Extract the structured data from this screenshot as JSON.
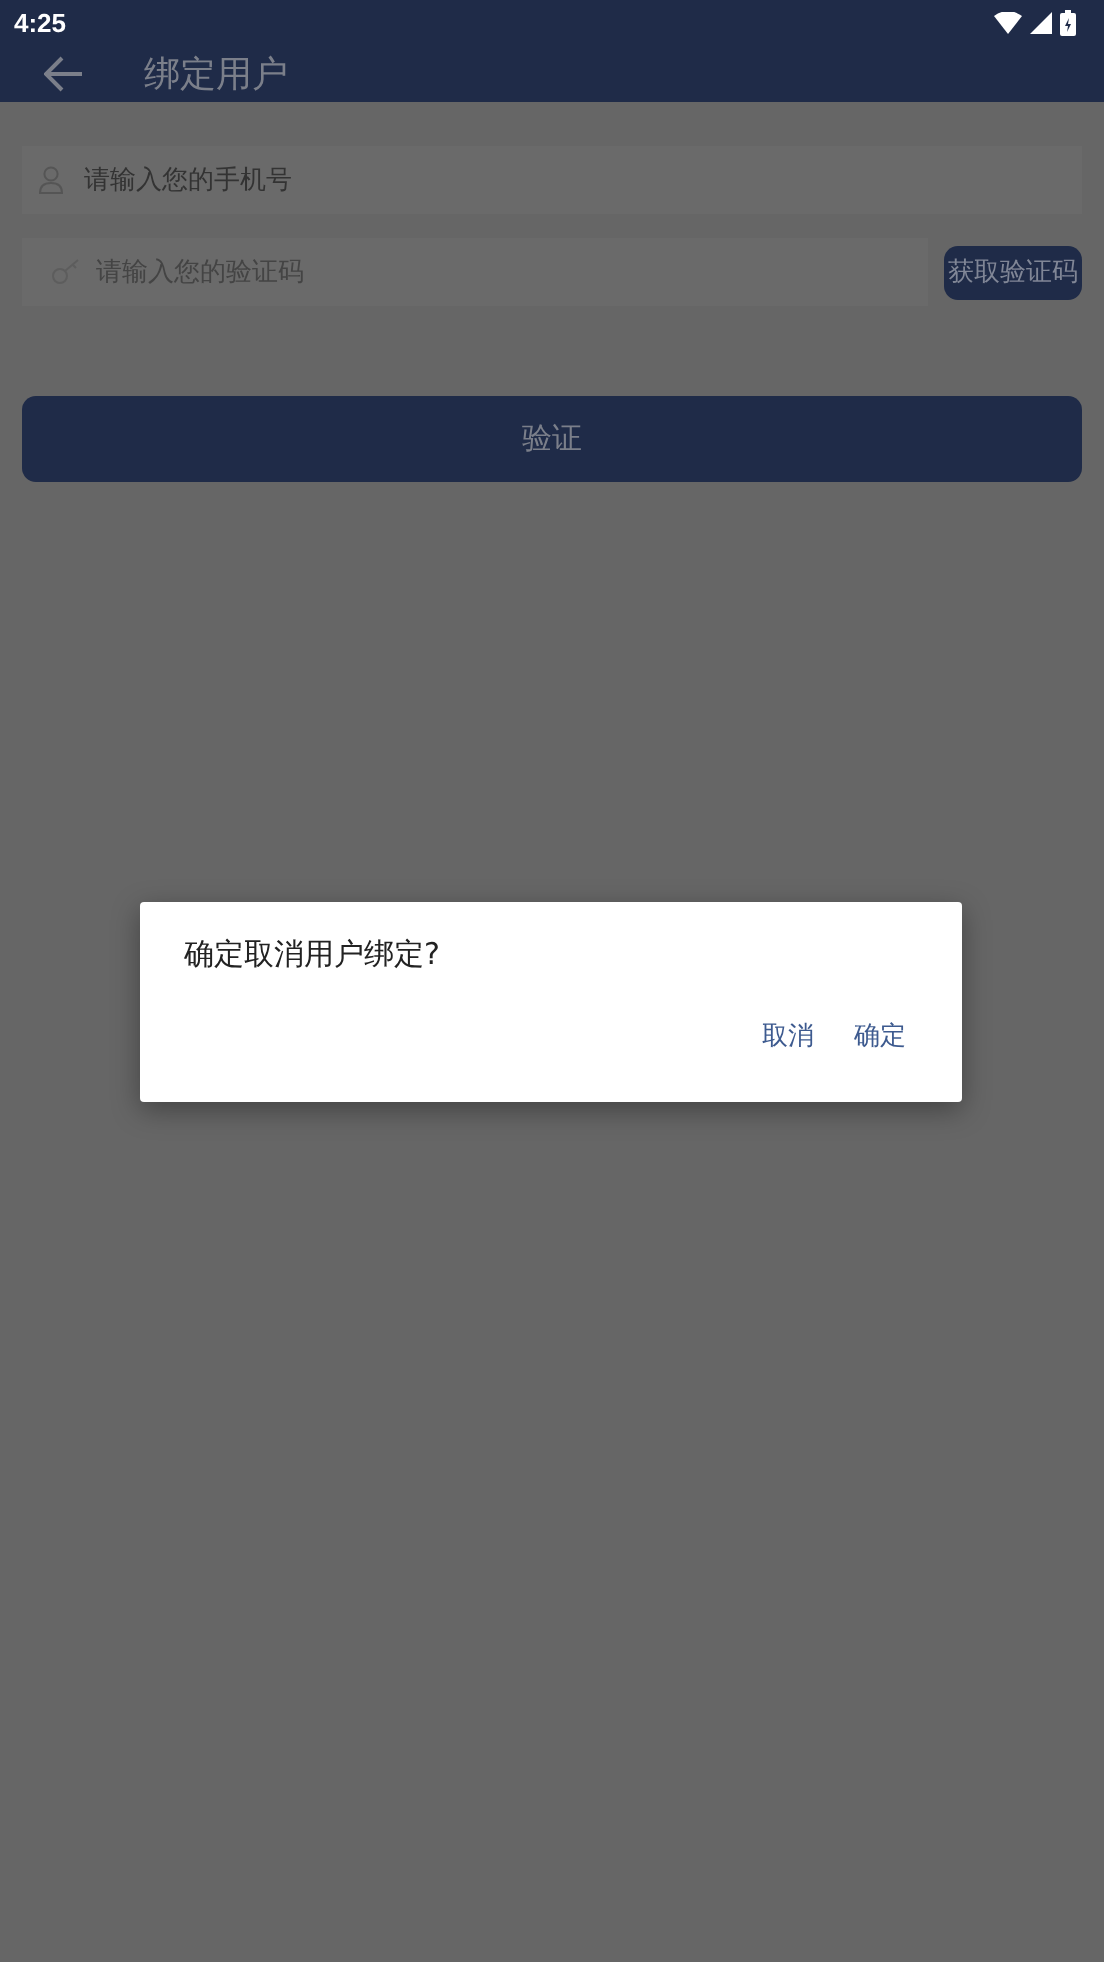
{
  "status_bar": {
    "time": "4:25"
  },
  "app_bar": {
    "title": "绑定用户"
  },
  "form": {
    "phone": {
      "placeholder": "请输入您的手机号"
    },
    "code": {
      "placeholder": "请输入您的验证码"
    },
    "get_code_button": "获取验证码",
    "verify_button": "验证"
  },
  "dialog": {
    "message": "确定取消用户绑定?",
    "buttons": [
      "取消",
      "确定"
    ]
  }
}
